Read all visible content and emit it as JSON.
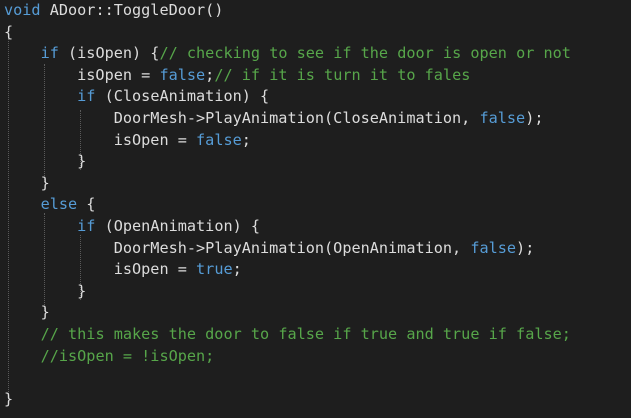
{
  "theme": {
    "background": "#1e1e1e",
    "text": "#dcdcdc",
    "keyword": "#569cd6",
    "comment": "#57a64a",
    "guide": "#5a5a5a"
  },
  "code": {
    "lines": [
      {
        "segments": [
          {
            "t": "kw",
            "v": "void"
          },
          {
            "t": "tx",
            "v": " ADoor::ToggleDoor()"
          }
        ]
      },
      {
        "segments": [
          {
            "t": "tx",
            "v": "{"
          }
        ]
      },
      {
        "segments": [
          {
            "t": "tx",
            "v": "    "
          },
          {
            "t": "kw",
            "v": "if"
          },
          {
            "t": "tx",
            "v": " (isOpen) {"
          },
          {
            "t": "cm",
            "v": "// checking to see if the door is open or not"
          }
        ]
      },
      {
        "segments": [
          {
            "t": "tx",
            "v": "        isOpen = "
          },
          {
            "t": "kw",
            "v": "false"
          },
          {
            "t": "tx",
            "v": ";"
          },
          {
            "t": "cm",
            "v": "// if it is turn it to fales"
          }
        ]
      },
      {
        "segments": [
          {
            "t": "tx",
            "v": "        "
          },
          {
            "t": "kw",
            "v": "if"
          },
          {
            "t": "tx",
            "v": " (CloseAnimation) {"
          }
        ]
      },
      {
        "segments": [
          {
            "t": "tx",
            "v": "            DoorMesh->PlayAnimation(CloseAnimation, "
          },
          {
            "t": "kw",
            "v": "false"
          },
          {
            "t": "tx",
            "v": ");"
          }
        ]
      },
      {
        "segments": [
          {
            "t": "tx",
            "v": "            isOpen = "
          },
          {
            "t": "kw",
            "v": "false"
          },
          {
            "t": "tx",
            "v": ";"
          }
        ]
      },
      {
        "segments": [
          {
            "t": "tx",
            "v": "        }"
          }
        ]
      },
      {
        "segments": [
          {
            "t": "tx",
            "v": "    }"
          }
        ]
      },
      {
        "segments": [
          {
            "t": "tx",
            "v": "    "
          },
          {
            "t": "kw",
            "v": "else"
          },
          {
            "t": "tx",
            "v": " {"
          }
        ]
      },
      {
        "segments": [
          {
            "t": "tx",
            "v": "        "
          },
          {
            "t": "kw",
            "v": "if"
          },
          {
            "t": "tx",
            "v": " (OpenAnimation) {"
          }
        ]
      },
      {
        "segments": [
          {
            "t": "tx",
            "v": "            DoorMesh->PlayAnimation(OpenAnimation, "
          },
          {
            "t": "kw",
            "v": "false"
          },
          {
            "t": "tx",
            "v": ");"
          }
        ]
      },
      {
        "segments": [
          {
            "t": "tx",
            "v": "            isOpen = "
          },
          {
            "t": "kw",
            "v": "true"
          },
          {
            "t": "tx",
            "v": ";"
          }
        ]
      },
      {
        "segments": [
          {
            "t": "tx",
            "v": "        }"
          }
        ]
      },
      {
        "segments": [
          {
            "t": "tx",
            "v": "    }"
          }
        ]
      },
      {
        "segments": [
          {
            "t": "tx",
            "v": "    "
          },
          {
            "t": "cm",
            "v": "// this makes the door to false if true and true if false;"
          }
        ]
      },
      {
        "segments": [
          {
            "t": "tx",
            "v": "    "
          },
          {
            "t": "cm",
            "v": "//isOpen = !isOpen;"
          }
        ]
      },
      {
        "segments": []
      },
      {
        "segments": [
          {
            "t": "tx",
            "v": "}"
          }
        ]
      }
    ]
  }
}
